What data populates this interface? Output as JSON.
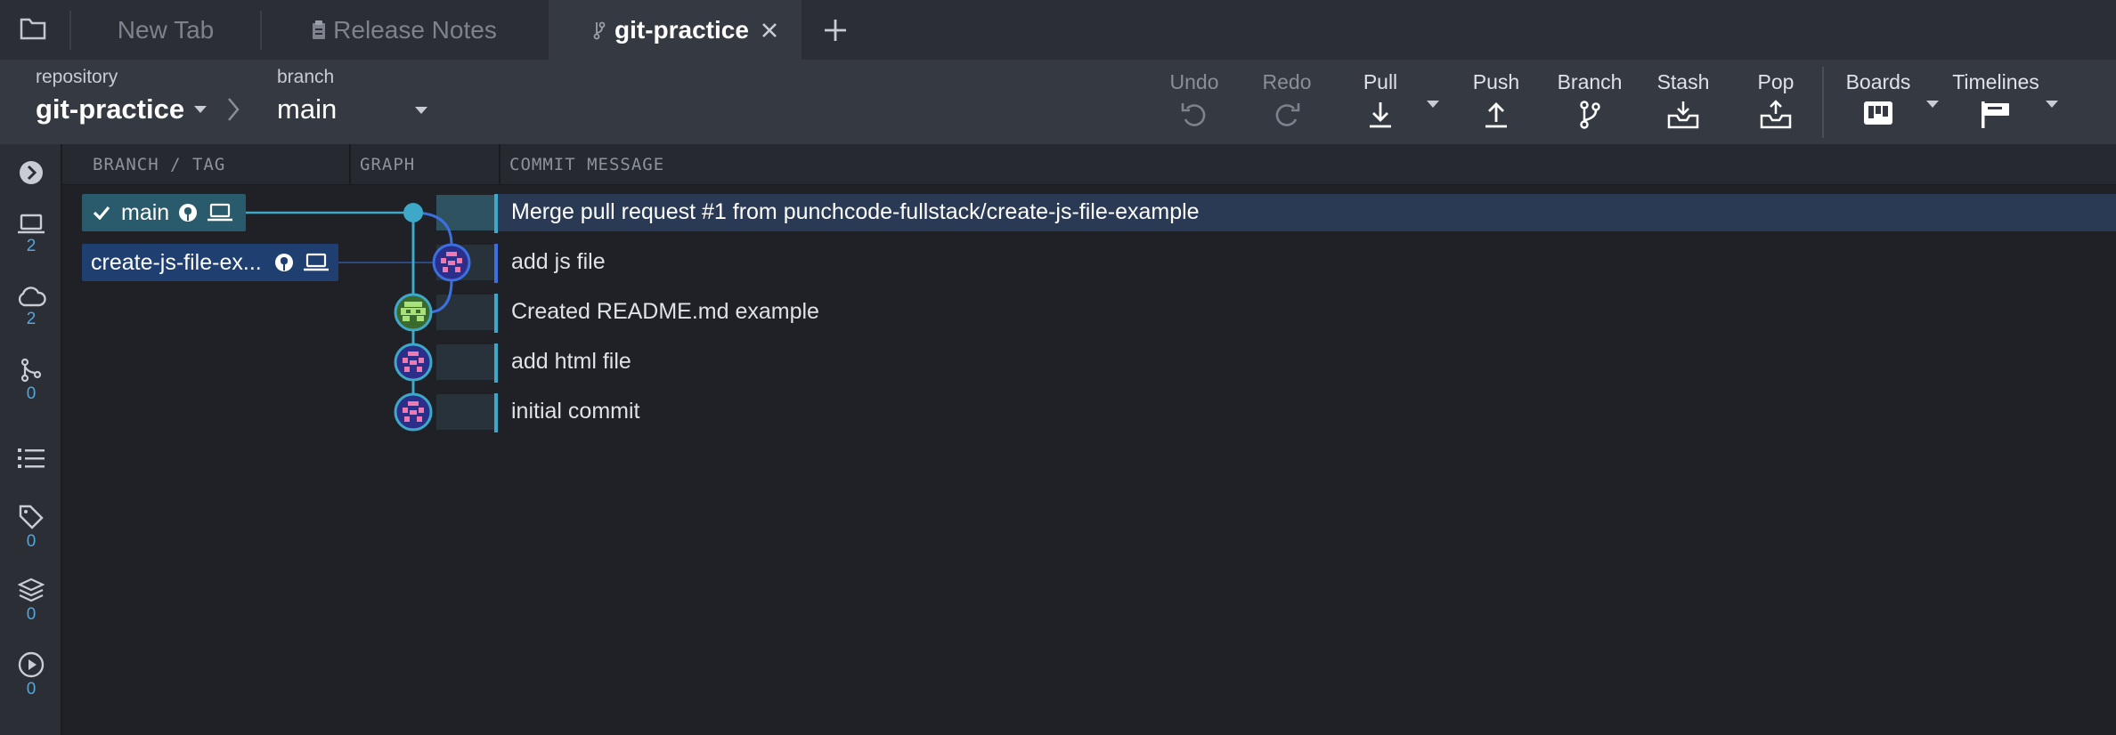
{
  "tabs": {
    "items": [
      {
        "label": "New Tab"
      },
      {
        "label": "Release Notes"
      },
      {
        "label": "git-practice"
      }
    ]
  },
  "toolbar": {
    "repository_caption": "repository",
    "repository_name": "git-practice",
    "branch_caption": "branch",
    "branch_name": "main",
    "undo": "Undo",
    "redo": "Redo",
    "pull": "Pull",
    "push": "Push",
    "branch": "Branch",
    "stash": "Stash",
    "pop": "Pop",
    "boards": "Boards",
    "timelines": "Timelines"
  },
  "rail": {
    "local_count": "2",
    "remote_count": "2",
    "pr_count": "0",
    "tags_count": "0",
    "stashes_count": "0",
    "actions_count": "0"
  },
  "columns": {
    "branch_tag": "BRANCH / TAG",
    "graph": "GRAPH",
    "commit_message": "COMMIT MESSAGE"
  },
  "refs": [
    {
      "label": "main"
    },
    {
      "label": "create-js-file-ex..."
    }
  ],
  "commits": [
    {
      "message": "Merge pull request #1 from punchcode-fullstack/create-js-file-example"
    },
    {
      "message": "add js file"
    },
    {
      "message": "Created README.md example"
    },
    {
      "message": "add html file"
    },
    {
      "message": "initial commit"
    }
  ],
  "colors": {
    "main_lane": "#3ea8c9",
    "branch_lane": "#3c6fe0",
    "selected_row": "#2a3a55",
    "ref_main": "#2a5b6c",
    "ref_branch": "#1f3f70"
  }
}
